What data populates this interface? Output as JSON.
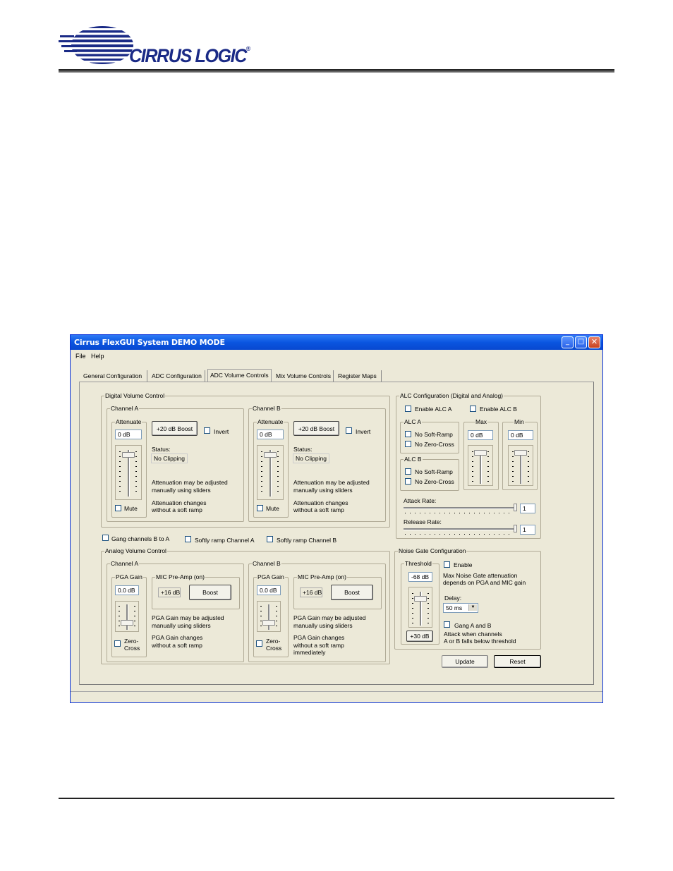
{
  "header": {
    "logo_text": "CIRRUS LOGIC",
    "logo_reg": "®",
    "brand_color": "#1a2a86"
  },
  "window": {
    "title": "Cirrus FlexGUI System DEMO MODE",
    "buttons": {
      "minimize": "_",
      "maximize": "□",
      "close": "✕"
    },
    "menu": {
      "file": "File",
      "help": "Help"
    },
    "tabs": [
      "General Configuration",
      "ADC Configuration",
      "ADC Volume Controls",
      "Mix Volume Controls",
      "Register Maps"
    ],
    "active_tab": "ADC Volume Controls"
  },
  "digital": {
    "group_label": "Digital Volume Control",
    "channel_a": {
      "label": "Channel A",
      "attenuate_label": "Attenuate",
      "attenuate_value": "0 dB",
      "boost_button": "+20 dB Boost",
      "invert_label": "Invert",
      "status_label": "Status:",
      "status_value": "No Clipping",
      "note1a": "Attenuation may be adjusted",
      "note1b": "manually using sliders",
      "note2a": "Attenuation changes",
      "note2b": "without a soft ramp",
      "mute_label": "Mute"
    },
    "channel_b": {
      "label": "Channel B",
      "attenuate_label": "Attenuate",
      "attenuate_value": "0 dB",
      "boost_button": "+20 dB Boost",
      "invert_label": "Invert",
      "status_label": "Status:",
      "status_value": "No Clipping",
      "note1a": "Attenuation may be adjusted",
      "note1b": "manually using sliders",
      "note2a": "Attenuation changes",
      "note2b": "without a soft ramp",
      "mute_label": "Mute"
    }
  },
  "options": {
    "gang_label": "Gang channels B to A",
    "soft_a_label": "Softly ramp Channel A",
    "soft_b_label": "Softly ramp Channel B"
  },
  "analog": {
    "group_label": "Analog Volume Control",
    "channel_a": {
      "label": "Channel A",
      "pga_label": "PGA Gain",
      "pga_value": "0.0 dB",
      "mic_label": "MIC Pre-Amp (on)",
      "mic_value": "+16 dB",
      "boost_button": "Boost",
      "note1a": "PGA Gain may be adjusted",
      "note1b": "manually using sliders",
      "note2a": "PGA Gain changes",
      "note2b": "without a soft ramp",
      "note2c": "",
      "zc_label1": "Zero-",
      "zc_label2": "Cross"
    },
    "channel_b": {
      "label": "Channel B",
      "pga_label": "PGA Gain",
      "pga_value": "0.0 dB",
      "mic_label": "MIC Pre-Amp (on)",
      "mic_value": "+16 dB",
      "boost_button": "Boost",
      "note1a": "PGA Gain may be adjusted",
      "note1b": "manually using sliders",
      "note2a": "PGA Gain changes",
      "note2b": "without a soft ramp",
      "note2c": "immediately",
      "zc_label1": "Zero-",
      "zc_label2": "Cross"
    }
  },
  "alc": {
    "group_label": "ALC Configuration (Digital and Analog)",
    "enable_a_label": "Enable ALC A",
    "enable_b_label": "Enable ALC B",
    "alc_a": {
      "label": "ALC A",
      "soft_ramp": "No Soft-Ramp",
      "zero_cross": "No Zero-Cross"
    },
    "alc_b": {
      "label": "ALC B",
      "soft_ramp": "No Soft-Ramp",
      "zero_cross": "No Zero-Cross"
    },
    "max": {
      "label": "Max",
      "value": "0 dB"
    },
    "min": {
      "label": "Min",
      "value": "0 dB"
    },
    "attack_label": "Attack Rate:",
    "attack_value": "1",
    "release_label": "Release Rate:",
    "release_value": "1"
  },
  "noise_gate": {
    "group_label": "Noise Gate Configuration",
    "threshold_label": "Threshold",
    "threshold_value": "-68 dB",
    "threshold_button": "+30 dB",
    "enable_label": "Enable",
    "desc1": "Max Noise Gate attenuation",
    "desc2": "depends on PGA and MIC gain",
    "delay_label": "Delay:",
    "delay_value": "50 ms",
    "gang_label": "Gang A and B",
    "attack1": "Attack when channels",
    "attack2": "A or B falls below threshold"
  },
  "actions": {
    "update": "Update",
    "reset": "Reset"
  }
}
